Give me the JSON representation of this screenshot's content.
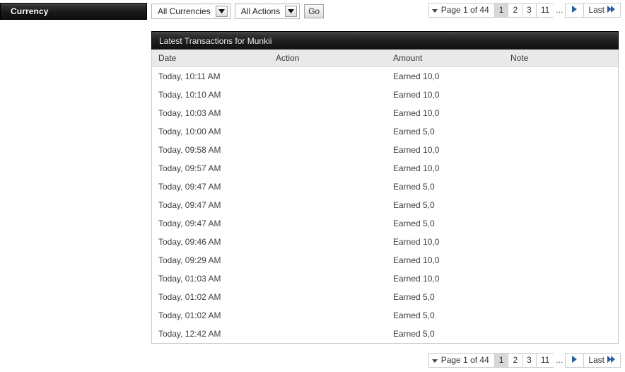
{
  "section": {
    "title": "Currency"
  },
  "toolbar": {
    "currency_filter": {
      "selected": "All Currencies",
      "icon": "chevron-down-icon"
    },
    "action_filter": {
      "selected": "All Actions",
      "icon": "chevron-down-icon"
    },
    "go_label": "Go"
  },
  "pager": {
    "caret_icon": "caret-down-icon",
    "page_label": "Page 1 of 44",
    "pages": [
      "1",
      "2",
      "3",
      "11"
    ],
    "active_page": "1",
    "ellipsis": "...",
    "next_icon": "play-right-icon",
    "last_label": "Last",
    "last_icon": "double-chevron-right-icon"
  },
  "panel": {
    "title": "Latest Transactions for Munkii",
    "columns": [
      "Date",
      "Action",
      "Amount",
      "Note"
    ],
    "rows": [
      {
        "date": "Today, 10:11 AM",
        "action": "",
        "amount": "Earned 10,0",
        "note": ""
      },
      {
        "date": "Today, 10:10 AM",
        "action": "",
        "amount": "Earned 10,0",
        "note": ""
      },
      {
        "date": "Today, 10:03 AM",
        "action": "",
        "amount": "Earned 10,0",
        "note": ""
      },
      {
        "date": "Today, 10:00 AM",
        "action": "",
        "amount": "Earned 5,0",
        "note": ""
      },
      {
        "date": "Today, 09:58 AM",
        "action": "",
        "amount": "Earned 10,0",
        "note": ""
      },
      {
        "date": "Today, 09:57 AM",
        "action": "",
        "amount": "Earned 10,0",
        "note": ""
      },
      {
        "date": "Today, 09:47 AM",
        "action": "",
        "amount": "Earned 5,0",
        "note": ""
      },
      {
        "date": "Today, 09:47 AM",
        "action": "",
        "amount": "Earned 5,0",
        "note": ""
      },
      {
        "date": "Today, 09:47 AM",
        "action": "",
        "amount": "Earned 5,0",
        "note": ""
      },
      {
        "date": "Today, 09:46 AM",
        "action": "",
        "amount": "Earned 10,0",
        "note": ""
      },
      {
        "date": "Today, 09:29 AM",
        "action": "",
        "amount": "Earned 10,0",
        "note": ""
      },
      {
        "date": "Today, 01:03 AM",
        "action": "",
        "amount": "Earned 10,0",
        "note": ""
      },
      {
        "date": "Today, 01:02 AM",
        "action": "",
        "amount": "Earned 5,0",
        "note": ""
      },
      {
        "date": "Today, 01:02 AM",
        "action": "",
        "amount": "Earned 5,0",
        "note": ""
      },
      {
        "date": "Today, 12:42 AM",
        "action": "",
        "amount": "Earned 5,0",
        "note": ""
      }
    ]
  },
  "colors": {
    "header_dark": "#1a1a1a",
    "table_header_bg": "#e9e9e9",
    "active_page_bg": "#d8d8d8",
    "arrow_blue": "#2b5f9e"
  }
}
